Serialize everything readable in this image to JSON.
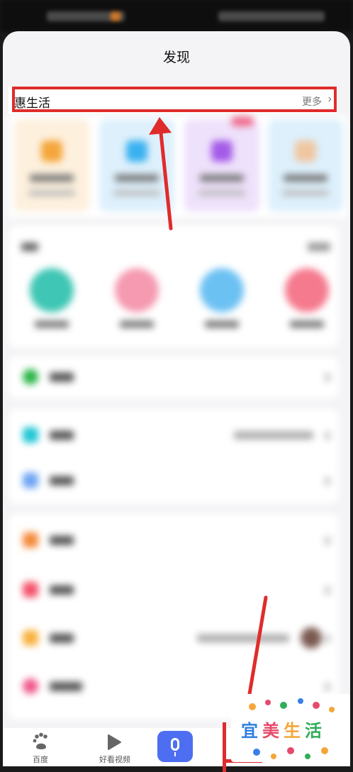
{
  "header": {
    "title": "发现"
  },
  "hui": {
    "title": "惠生活",
    "more": "更多",
    "chevron": "›"
  },
  "tabbar": {
    "home": "百度",
    "video": "好看视频"
  },
  "logo": {
    "text": [
      "宜",
      "美",
      "生",
      "活"
    ]
  },
  "colors": {
    "accent": "#4e6ef2",
    "annotation": "#e02b2b",
    "sheet": "#f4f4f6"
  }
}
